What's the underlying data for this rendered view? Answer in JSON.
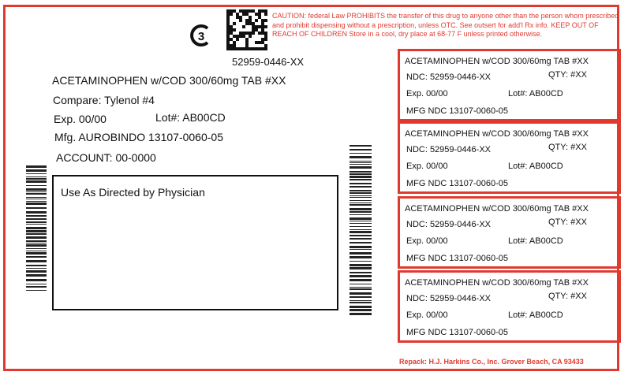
{
  "label": {
    "schedule_symbol": "CIII",
    "caution": "CAUTION: federal Law PROHIBITS the transfer of this drug to anyone other than the person whom prescribed and prohibit dispensing without a prescription, unless OTC. See outsert for add'l Rx info. KEEP OUT OF REACH OF CHILDREN Store in a cool, dry place at 68-77 F unless printed otherwise.",
    "ndc_top": "52959-0446-XX",
    "drug_name": "ACETAMINOPHEN w/COD 300/60mg TAB #XX",
    "compare": "Compare: Tylenol #4",
    "exp": "Exp. 00/00",
    "lot": "Lot#: AB00CD",
    "mfg": "Mfg. AUROBINDO 13107-0060-05",
    "account": "ACCOUNT: 00-0000",
    "directions": "Use As Directed by Physician",
    "repack": "Repack: H.J. Harkins Co., Inc. Grover Beach, CA 93433",
    "accent_color": "#e03a2f"
  },
  "mini_labels": [
    {
      "drug": "ACETAMINOPHEN w/COD 300/60mg TAB #XX",
      "ndc": "NDC: 52959-0446-XX",
      "qty": "QTY: #XX",
      "exp": "Exp. 00/00",
      "lot": "Lot#: AB00CD",
      "mfg": "MFG NDC 13107-0060-05"
    },
    {
      "drug": "ACETAMINOPHEN w/COD 300/60mg TAB #XX",
      "ndc": "NDC: 52959-0446-XX",
      "qty": "QTY: #XX",
      "exp": "Exp. 00/00",
      "lot": "Lot#: AB00CD",
      "mfg": "MFG NDC 13107-0060-05"
    },
    {
      "drug": "ACETAMINOPHEN w/COD 300/60mg TAB #XX",
      "ndc": "NDC: 52959-0446-XX",
      "qty": "QTY: #XX",
      "exp": "Exp. 00/00",
      "lot": "Lot#: AB00CD",
      "mfg": "MFG NDC 13107-0060-05"
    },
    {
      "drug": "ACETAMINOPHEN w/COD 300/60mg TAB #XX",
      "ndc": "NDC: 52959-0446-XX",
      "qty": "QTY: #XX",
      "exp": "Exp. 00/00",
      "lot": "Lot#: AB00CD",
      "mfg": "MFG NDC 13107-0060-05"
    }
  ]
}
